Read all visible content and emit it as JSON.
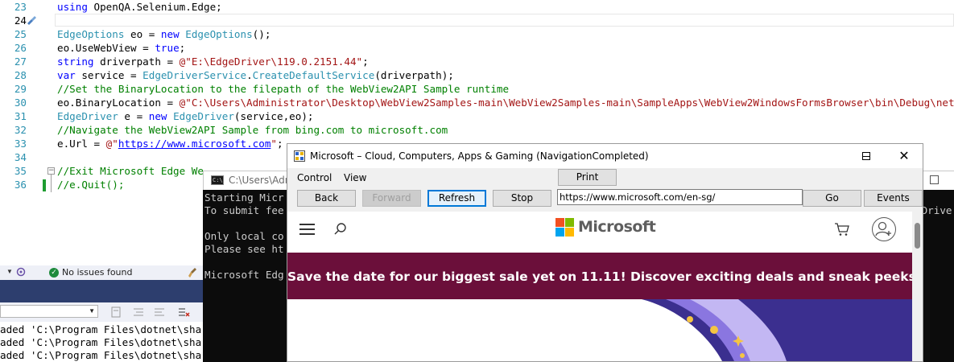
{
  "editor": {
    "lines": [
      {
        "num": "23",
        "parts": [
          [
            "kw",
            "using"
          ],
          [
            "",
            "OpenQA.Selenium.Edge;"
          ]
        ],
        "sep": " "
      },
      {
        "num": "24",
        "parts": [],
        "sep": ""
      },
      {
        "num": "25",
        "parts": [
          [
            "ty",
            "EdgeOptions"
          ],
          [
            "",
            " eo = "
          ],
          [
            "kw",
            "new"
          ],
          [
            "",
            " "
          ],
          [
            "ty",
            "EdgeOptions"
          ],
          [
            "",
            "();"
          ]
        ],
        "sep": ""
      },
      {
        "num": "26",
        "parts": [
          [
            "",
            "eo.UseWebView = "
          ],
          [
            "kw",
            "true"
          ],
          [
            "",
            ";"
          ]
        ],
        "sep": ""
      },
      {
        "num": "27",
        "parts": [
          [
            "kw",
            "string"
          ],
          [
            "",
            " driverpath = "
          ],
          [
            "st",
            "@\"E:\\EdgeDriver\\119.0.2151.44\""
          ],
          [
            "",
            ";"
          ]
        ],
        "sep": ""
      },
      {
        "num": "28",
        "parts": [
          [
            "kw",
            "var"
          ],
          [
            "",
            " service = "
          ],
          [
            "ty",
            "EdgeDriverService"
          ],
          [
            "",
            "."
          ],
          [
            "ty",
            "CreateDefaultService"
          ],
          [
            "",
            "(driverpath);"
          ]
        ],
        "sep": ""
      },
      {
        "num": "29",
        "parts": [
          [
            "cm",
            "//Set the BinaryLocation to the filepath of the WebView2API Sample runtime"
          ]
        ],
        "sep": ""
      },
      {
        "num": "30",
        "parts": [
          [
            "",
            "eo.BinaryLocation = "
          ],
          [
            "st",
            "@\"C:\\Users\\Administrator\\Desktop\\WebView2Samples-main\\WebView2Samples-main\\SampleApps\\WebView2WindowsFormsBrowser\\bin\\Debug\\net"
          ]
        ],
        "sep": ""
      },
      {
        "num": "31",
        "parts": [
          [
            "ty",
            "EdgeDriver"
          ],
          [
            "",
            " e = "
          ],
          [
            "kw",
            "new"
          ],
          [
            "",
            " "
          ],
          [
            "ty",
            "EdgeDriver"
          ],
          [
            "",
            "(service,eo);"
          ]
        ],
        "sep": ""
      },
      {
        "num": "32",
        "parts": [
          [
            "cm",
            "//Navigate the WebView2API Sample from bing.com to microsoft.com"
          ]
        ],
        "sep": ""
      },
      {
        "num": "33",
        "parts": [
          [
            "",
            "e.Url = "
          ],
          [
            "st",
            "@\""
          ],
          [
            "lk",
            "https://www.microsoft.com"
          ],
          [
            "st",
            "\""
          ],
          [
            "",
            ";"
          ]
        ],
        "sep": ""
      },
      {
        "num": "34",
        "parts": [],
        "sep": ""
      },
      {
        "num": "35",
        "parts": [
          [
            "cm",
            "//Exit Microsoft Edge We"
          ]
        ],
        "sep": ""
      },
      {
        "num": "36",
        "parts": [
          [
            "cm",
            "//e.Quit();"
          ]
        ],
        "sep": ""
      }
    ]
  },
  "status": {
    "issues": "No issues found"
  },
  "output": {
    "lines": [
      "aded 'C:\\Program Files\\dotnet\\shared\\",
      "aded 'C:\\Program Files\\dotnet\\shared\\",
      "aded 'C:\\Program Files\\dotnet\\shared\\"
    ]
  },
  "console": {
    "title": "C:\\Users\\Adm",
    "lines": [
      "Starting Micr",
      "To submit fee",
      "",
      "Only local co",
      "Please see ht",
      "",
      "Microsoft Edg"
    ],
    "right_fragment": "oDrive"
  },
  "browser": {
    "title": "Microsoft – Cloud, Computers, Apps & Gaming (NavigationCompleted)",
    "menu": {
      "control": "Control",
      "view": "View"
    },
    "print": "Print",
    "back": "Back",
    "forward": "Forward",
    "refresh": "Refresh",
    "stop": "Stop",
    "url": "https://www.microsoft.com/en-sg/",
    "go": "Go",
    "events": "Events",
    "close_glyph": "✕",
    "page": {
      "brand": "Microsoft",
      "promo": "Save the date for our biggest sale yet on 11.11! Discover exciting deals and sneak peeks",
      "promo_arrow": "›"
    }
  },
  "colors": {
    "promo_bg": "#6b0f3a",
    "ms_red": "#f25022",
    "ms_green": "#7fba00",
    "ms_blue": "#00a4ef",
    "ms_yellow": "#ffb900"
  }
}
